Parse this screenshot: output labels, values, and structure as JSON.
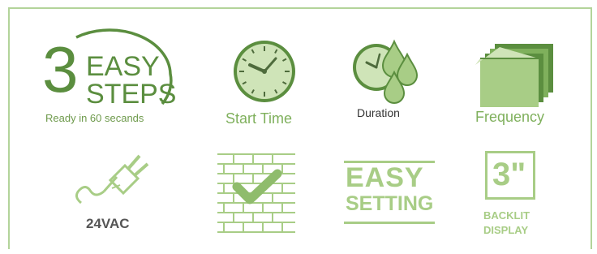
{
  "colors": {
    "dark_green": "#5b8e3f",
    "mid_green": "#7fb05c",
    "light_green": "#a8cd86",
    "pale_green": "#cfe4b8",
    "dial_line": "#4e6b3c",
    "gray_text": "#555555",
    "frame": "#b3d49a"
  },
  "steps_logo": {
    "number": "3",
    "word1": "EASY",
    "word2": "STEPS",
    "tagline": "Ready in 60 secands"
  },
  "features": [
    {
      "icon": "clock-icon",
      "label": "Start Time"
    },
    {
      "icon": "clock-water-drops-icon",
      "label": "Duration"
    },
    {
      "icon": "calendar-stack-icon",
      "label": "Frequency"
    },
    {
      "icon": "power-plug-icon",
      "label": "24VAC"
    },
    {
      "icon": "brick-wall-checkmark-icon",
      "label": ""
    },
    {
      "icon": "easy-setting-badge-icon",
      "label": "",
      "badge_line1": "EASY",
      "badge_line2": "SETTING"
    },
    {
      "icon": "backlit-display-icon",
      "label": "",
      "screen_text": "3\"",
      "caption_line1": "BACKLIT",
      "caption_line2": "DISPLAY"
    }
  ]
}
